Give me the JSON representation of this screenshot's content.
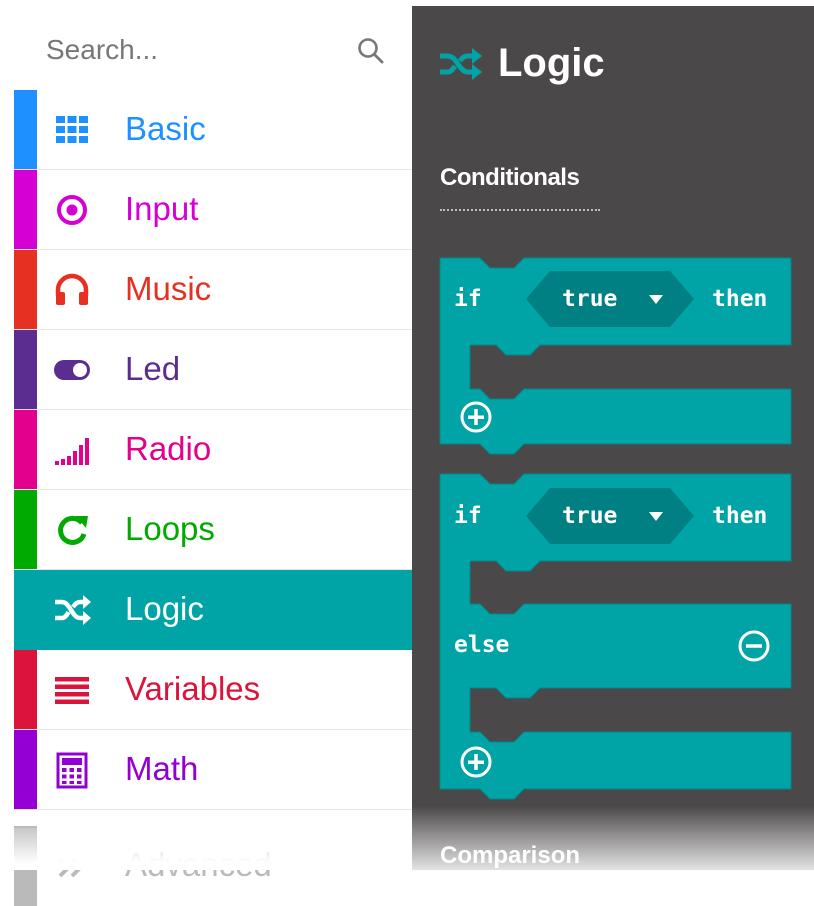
{
  "search": {
    "placeholder": "Search..."
  },
  "categories": [
    {
      "id": "basic",
      "label": "Basic",
      "color": "#1e90ff",
      "icon": "grid-icon"
    },
    {
      "id": "input",
      "label": "Input",
      "color": "#d400d4",
      "icon": "target-icon"
    },
    {
      "id": "music",
      "label": "Music",
      "color": "#e63022",
      "icon": "headphones-icon"
    },
    {
      "id": "led",
      "label": "Led",
      "color": "#5c2d91",
      "icon": "toggle-icon"
    },
    {
      "id": "radio",
      "label": "Radio",
      "color": "#e3008c",
      "icon": "signal-bars-icon"
    },
    {
      "id": "loops",
      "label": "Loops",
      "color": "#00aa00",
      "icon": "refresh-icon"
    },
    {
      "id": "logic",
      "label": "Logic",
      "color": "#00a4a6",
      "icon": "shuffle-icon",
      "selected": true
    },
    {
      "id": "variables",
      "label": "Variables",
      "color": "#dc143c",
      "icon": "list-icon"
    },
    {
      "id": "math",
      "label": "Math",
      "color": "#9400d3",
      "icon": "calculator-icon"
    },
    {
      "id": "advanced",
      "label": "Advanced",
      "color": "#3c3c3c",
      "icon": "chevron-icon"
    }
  ],
  "flyout": {
    "title": "Logic",
    "sections": {
      "conditionals": "Conditionals",
      "comparison": "Comparison"
    },
    "block_color": "#00a4a6",
    "block_dark": "#008082",
    "blocks": {
      "if_then": {
        "if": "if",
        "value": "true",
        "then": "then"
      },
      "if_else": {
        "if": "if",
        "value": "true",
        "then": "then",
        "else": "else"
      }
    }
  }
}
